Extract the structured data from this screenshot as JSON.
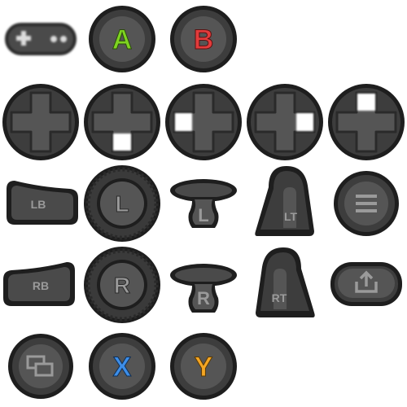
{
  "colors": {
    "outline": "#1e1e1e",
    "body": "#3d3d3d",
    "face": "#555555",
    "highlight": "#ffffff",
    "label_gray": "#9a9a9a",
    "a_green": "#7ed321",
    "b_red": "#e23b3b",
    "x_blue": "#3d8ee8",
    "y_gold": "#f5a623"
  },
  "tiles": {
    "gamepad": {
      "icon": "gamepad-icon"
    },
    "a": {
      "label": "A"
    },
    "b": {
      "label": "B"
    },
    "dpad_neutral": {
      "pressed": "none"
    },
    "dpad_down": {
      "pressed": "down"
    },
    "dpad_left": {
      "pressed": "left"
    },
    "dpad_right": {
      "pressed": "right"
    },
    "dpad_up": {
      "pressed": "up"
    },
    "lb": {
      "label": "LB"
    },
    "l_stick": {
      "label": "L"
    },
    "l_stick_side": {
      "label": "L"
    },
    "lt": {
      "label": "LT"
    },
    "menu": {
      "icon": "menu-icon"
    },
    "rb": {
      "label": "RB"
    },
    "r_stick": {
      "label": "R"
    },
    "r_stick_side": {
      "label": "R"
    },
    "rt": {
      "label": "RT"
    },
    "share": {
      "icon": "share-icon"
    },
    "view": {
      "icon": "view-icon"
    },
    "x": {
      "label": "X"
    },
    "y": {
      "label": "Y"
    }
  }
}
